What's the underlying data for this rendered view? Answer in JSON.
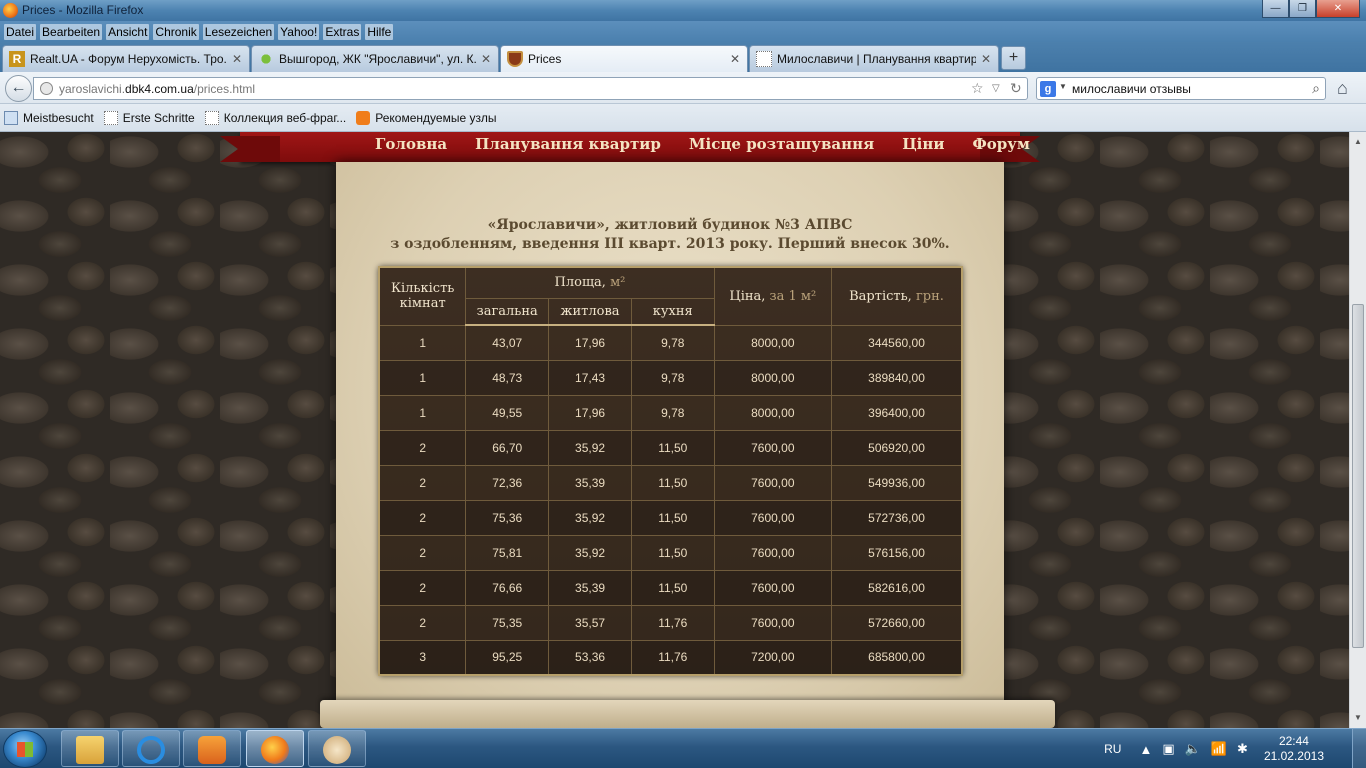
{
  "window": {
    "title": "Prices - Mozilla Firefox",
    "buttons": {
      "minimize": "—",
      "maximize": "❐",
      "close": "✕"
    }
  },
  "menu": [
    "Datei",
    "Bearbeiten",
    "Ansicht",
    "Chronik",
    "Lesezeichen",
    "Yahoo!",
    "Extras",
    "Hilfe"
  ],
  "tabs": [
    {
      "label": "Realt.UA - Форум Нерухомість. Тро...",
      "icon": "realt-favicon",
      "active": false
    },
    {
      "label": "Вышгород, ЖК \"Ярославичи\", ул. К...",
      "icon": "leaf-favicon",
      "active": false
    },
    {
      "label": "Prices",
      "icon": "shield-favicon",
      "active": true
    },
    {
      "label": "Милославичи | Планування квартир",
      "icon": "blank-favicon",
      "active": false
    }
  ],
  "new_tab_label": "+",
  "address": {
    "prefix": "yaroslavichi.",
    "domain": "dbk4.com.ua",
    "path": "/prices.html"
  },
  "search": {
    "query": "милославичи отзывы",
    "engine": "Google"
  },
  "bookmarks": [
    {
      "label": "Meistbesucht",
      "icon": "star-folder-icon"
    },
    {
      "label": "Erste Schritte",
      "icon": "page-icon"
    },
    {
      "label": "Коллекция веб-фраг...",
      "icon": "page-icon"
    },
    {
      "label": "Рекомендуемые узлы",
      "icon": "bulb-icon"
    }
  ],
  "site_nav": [
    "Головна",
    "Планування квартир",
    "Місце розташування",
    "Ціни",
    "Форум"
  ],
  "heading": {
    "line1": "«Ярославичи», житловий будинок №3 АПВС",
    "line2": "з оздобленням, введення III кварт. 2013 року. Перший внесок 30%."
  },
  "table": {
    "headers": {
      "rooms": "Кількість кімнат",
      "area": "Площа,",
      "area_unit": "м²",
      "total": "загальна",
      "living": "житлова",
      "kitchen": "кухня",
      "price": "Ціна,",
      "price_unit": "за 1 м²",
      "cost": "Вартість,",
      "cost_unit": "грн."
    },
    "rows": [
      [
        "1",
        "43,07",
        "17,96",
        "9,78",
        "8000,00",
        "344560,00"
      ],
      [
        "1",
        "48,73",
        "17,43",
        "9,78",
        "8000,00",
        "389840,00"
      ],
      [
        "1",
        "49,55",
        "17,96",
        "9,78",
        "8000,00",
        "396400,00"
      ],
      [
        "2",
        "66,70",
        "35,92",
        "11,50",
        "7600,00",
        "506920,00"
      ],
      [
        "2",
        "72,36",
        "35,39",
        "11,50",
        "7600,00",
        "549936,00"
      ],
      [
        "2",
        "75,36",
        "35,92",
        "11,50",
        "7600,00",
        "572736,00"
      ],
      [
        "2",
        "75,81",
        "35,92",
        "11,50",
        "7600,00",
        "576156,00"
      ],
      [
        "2",
        "76,66",
        "35,39",
        "11,50",
        "7600,00",
        "582616,00"
      ],
      [
        "2",
        "75,35",
        "35,57",
        "11,76",
        "7600,00",
        "572660,00"
      ],
      [
        "3",
        "95,25",
        "53,36",
        "11,76",
        "7200,00",
        "685800,00"
      ]
    ]
  },
  "taskbar": {
    "items": [
      {
        "name": "explorer",
        "icon": "folder-icon",
        "active": false
      },
      {
        "name": "internet-explorer",
        "icon": "ie-icon",
        "active": false
      },
      {
        "name": "media-player",
        "icon": "media-player-icon",
        "active": false
      },
      {
        "name": "firefox",
        "icon": "firefox-icon",
        "active": true
      },
      {
        "name": "paint",
        "icon": "paint-icon",
        "active": false
      }
    ],
    "language": "RU",
    "time": "22:44",
    "date": "21.02.2013"
  },
  "colors": {
    "ribbon": "#a01616",
    "parchment": "#e4d8bf",
    "table_bg": "#3a2b20",
    "nav_text": "#f4e3c2"
  }
}
